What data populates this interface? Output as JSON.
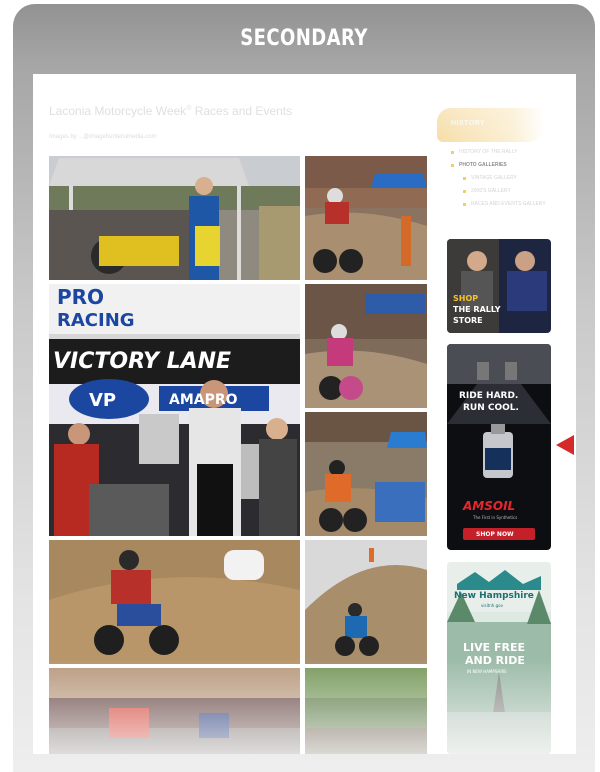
{
  "card": {
    "title": "SECONDARY"
  },
  "article": {
    "title": "Laconia Motorcycle Week",
    "title_sup": "®",
    "title_suffix": " Races and Events",
    "credit": "Images by ...@imagehuntersimedia.com"
  },
  "sidebar": {
    "history_label": "HISTORY",
    "menu": [
      {
        "label": "HISTORY OF THE RALLY",
        "level": 0,
        "active": false
      },
      {
        "label": "PHOTO GALLERIES",
        "level": 0,
        "active": true
      },
      {
        "label": "VINTAGE GALLERY",
        "level": 1,
        "active": false
      },
      {
        "label": "2000'S GALLERY",
        "level": 1,
        "active": false
      },
      {
        "label": "RACES AND EVENTS GALLERY",
        "level": 1,
        "active": false
      }
    ]
  },
  "photos": {
    "p2": {
      "banner_top": "PRO",
      "banner_top2": "RACING",
      "banner_mid": "VICTORY LANE",
      "logo": "VP",
      "logo2": "AMAPRO"
    }
  },
  "ads": {
    "rally_store": {
      "line1": "SHOP",
      "line2": "THE RALLY",
      "line3": "STORE"
    },
    "amsoil": {
      "headline1": "RIDE HARD.",
      "headline2": "RUN COOL.",
      "brand": "AMSOIL",
      "tagline": "The First in Synthetics",
      "cta": "SHOP NOW"
    },
    "nh": {
      "title": "New Hampshire",
      "url": "visitnh.gov",
      "line1": "LIVE FREE",
      "line2": "AND RIDE",
      "line3": "IN NEW HAMPSHIRE"
    }
  },
  "colors": {
    "marker": "#d42a2a",
    "amsoil_red": "#c4202a",
    "nh_teal": "#2a8a8c",
    "history_gold": "#f3d595"
  }
}
